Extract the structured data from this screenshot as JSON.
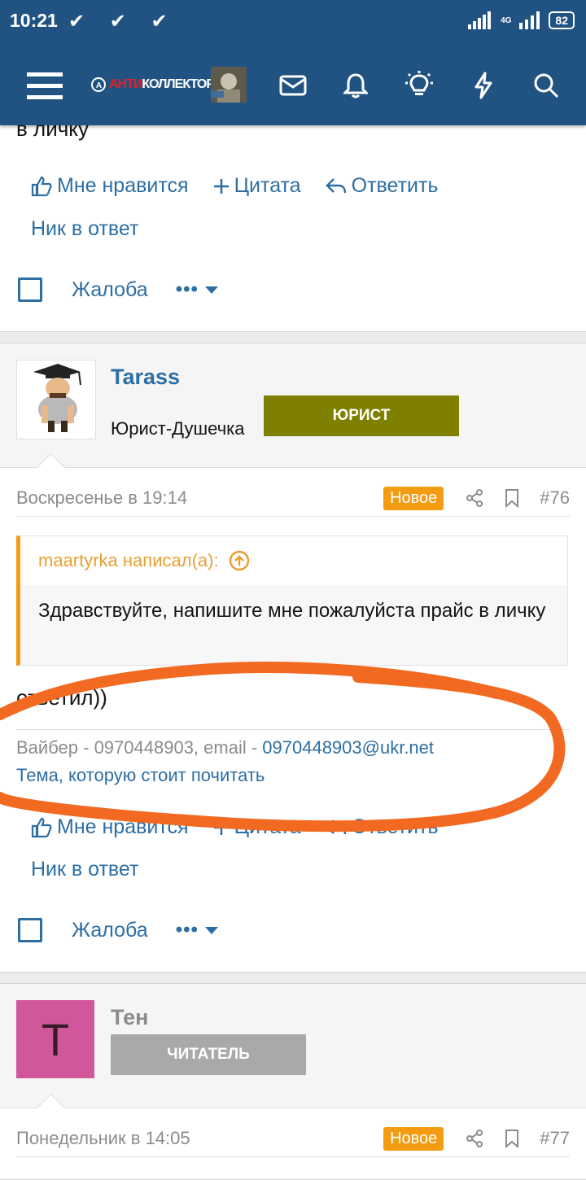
{
  "status_bar": {
    "time": "10:21",
    "checks": "✔ ✔ ✔",
    "network": "4G",
    "battery": "82"
  },
  "app_bar": {
    "logo_prefix": "АНТИ",
    "logo_suffix": "КОЛЛЕКТОР"
  },
  "post_top": {
    "text_tail": "в личку",
    "like": "Мне нравится",
    "quote": "Цитата",
    "reply": "Ответить",
    "nick_reply": "Ник в ответ",
    "report": "Жалоба",
    "more": "•••"
  },
  "post_76": {
    "author": "Tarass",
    "user_title": "Юрист-Душечка",
    "role_badge": "ЮРИСТ",
    "date": "Воскресенье в 19:14",
    "new_label": "Новое",
    "post_number": "#76",
    "quote_author": "maartyrka написал(а):",
    "quote_text": "Здравствуйте, напишите мне пожалуйста прайс в личку",
    "message": "ответил))",
    "signature_prefix": "Вайбер - 0970448903, email - ",
    "signature_email": "0970448903@ukr.net",
    "signature_link": "Тема, которую стоит почитать",
    "like": "Мне нравится",
    "quote": "Цитата",
    "reply": "Ответить",
    "nick_reply": "Ник в ответ",
    "report": "Жалоба",
    "more": "•••"
  },
  "post_77": {
    "author": "Тен",
    "avatar_letter": "Т",
    "role_badge": "ЧИТАТЕЛЬ",
    "date": "Понедельник в 14:05",
    "new_label": "Новое",
    "post_number": "#77"
  },
  "colors": {
    "brand": "#215382",
    "link": "#2d6ea3",
    "new_badge": "#f39c12",
    "lawyer_badge": "#7f7f00",
    "reader_badge": "#a9a9a9",
    "avatar_pink": "#d0579a",
    "annotation": "#f26a22"
  }
}
